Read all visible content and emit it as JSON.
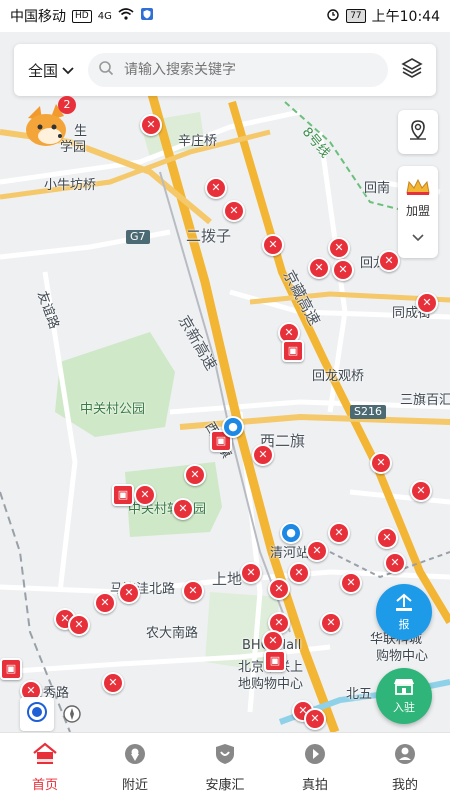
{
  "status_bar": {
    "carrier": "中国移动",
    "hd": "HD",
    "network": "4G",
    "battery": "77",
    "time": "上午10:44"
  },
  "search": {
    "region": "全国",
    "placeholder": "请输入搜索关键字"
  },
  "side_actions": {
    "join_label": "加盟"
  },
  "floating": {
    "report_label": "报",
    "checkin_label": "入驻"
  },
  "logo_badge_count": "2",
  "map": {
    "labels": [
      {
        "text": "辛庄桥",
        "cls": ""
      },
      {
        "text": "小牛坊桥",
        "cls": ""
      },
      {
        "text": "二拨子",
        "cls": "big"
      },
      {
        "text": "回南",
        "cls": ""
      },
      {
        "text": "回龙",
        "cls": ""
      },
      {
        "text": "同成街",
        "cls": ""
      },
      {
        "text": "友谊路",
        "cls": ""
      },
      {
        "text": "京新高速",
        "cls": "big"
      },
      {
        "text": "京藏高速",
        "cls": "big"
      },
      {
        "text": "回龙观桥",
        "cls": ""
      },
      {
        "text": "中关村公园",
        "cls": "green"
      },
      {
        "text": "西二旗",
        "cls": "big"
      },
      {
        "text": "三旗百汇",
        "cls": ""
      },
      {
        "text": "西二旗",
        "cls": ""
      },
      {
        "text": "中关村软件园",
        "cls": "green"
      },
      {
        "text": "清河站",
        "cls": ""
      },
      {
        "text": "上地",
        "cls": "big"
      },
      {
        "text": "马连洼北路",
        "cls": ""
      },
      {
        "text": "农大南路",
        "cls": ""
      },
      {
        "text": "BHG Mall",
        "cls": ""
      },
      {
        "text": "北京华联上",
        "cls": ""
      },
      {
        "text": "地购物中心",
        "cls": ""
      },
      {
        "text": "华联科城",
        "cls": ""
      },
      {
        "text": "购物中心",
        "cls": ""
      },
      {
        "text": "大秀路",
        "cls": ""
      },
      {
        "text": "北五",
        "cls": ""
      },
      {
        "text": "8号线",
        "cls": ""
      },
      {
        "text": "生",
        "cls": ""
      },
      {
        "text": "学园",
        "cls": ""
      }
    ],
    "road_badges": [
      "G7",
      "S216"
    ]
  },
  "nav": [
    {
      "label": "首页",
      "icon": "home-icon",
      "active": true
    },
    {
      "label": "附近",
      "icon": "location-pin-icon",
      "active": false
    },
    {
      "label": "安康汇",
      "icon": "shield-icon",
      "active": false
    },
    {
      "label": "真拍",
      "icon": "flame-icon",
      "active": false
    },
    {
      "label": "我的",
      "icon": "user-icon",
      "active": false
    }
  ],
  "colors": {
    "accent": "#e8303a",
    "highway": "#f2b534",
    "water": "#8fd1e8",
    "park": "#cfe8c8",
    "report_button": "#1e9be8",
    "checkin_button": "#2fb57a"
  }
}
